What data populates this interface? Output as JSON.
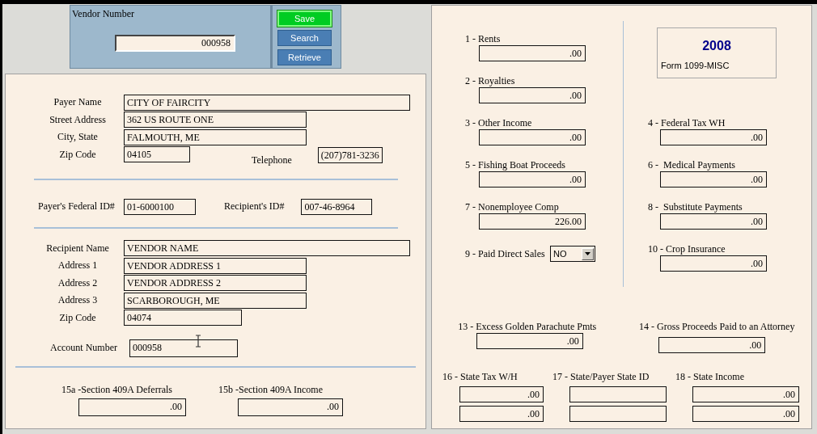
{
  "vendor_panel": {
    "label": "Vendor Number",
    "value": "000958"
  },
  "buttons": [
    {
      "label": "Save",
      "selected": true
    },
    {
      "label": "Search",
      "selected": false
    },
    {
      "label": "Retrieve",
      "selected": false
    }
  ],
  "payer": [
    {
      "label": "Payer Name",
      "value": "CITY OF FAIRCITY"
    },
    {
      "label": "Street Address",
      "value": "362 US ROUTE ONE"
    },
    {
      "label": "City, State",
      "value": "FALMOUTH, ME"
    },
    {
      "label": "Zip Code",
      "value": "04105"
    }
  ],
  "telephone": {
    "label": "Telephone",
    "value": "(207)781-3236"
  },
  "ids": [
    {
      "label": "Payer's Federal ID#",
      "value": "01-6000100"
    },
    {
      "label": "Recipient's ID#",
      "value": "007-46-8964"
    }
  ],
  "recipient": [
    {
      "label": "Recipient Name",
      "value": "VENDOR NAME"
    },
    {
      "label": "Address 1",
      "value": "VENDOR ADDRESS 1"
    },
    {
      "label": "Address 2",
      "value": "VENDOR ADDRESS 2"
    },
    {
      "label": "Address 3",
      "value": "SCARBOROUGH, ME"
    },
    {
      "label": "Zip Code",
      "value": "04074"
    }
  ],
  "account": {
    "label": "Account Number",
    "value": "000958"
  },
  "section_409a": [
    {
      "label": "15a -Section 409A Deferrals",
      "value": ".00"
    },
    {
      "label": "15b -Section 409A Income",
      "value": ".00"
    }
  ],
  "form_badge": {
    "year": "2008",
    "title": "Form 1099-MISC"
  },
  "boxes_left": [
    {
      "label": "1 - Rents",
      "value": ".00"
    },
    {
      "label": "2 - Royalties",
      "value": ".00"
    },
    {
      "label": "3 - Other Income",
      "value": ".00"
    },
    {
      "label": "5 - Fishing Boat Proceeds",
      "value": ".00"
    },
    {
      "label": "7 - Nonemployee Comp",
      "value": "226.00"
    }
  ],
  "paid_direct_sales": {
    "label": "9 - Paid Direct Sales",
    "value": "NO"
  },
  "boxes_right": [
    {
      "label": "4 - Federal Tax WH",
      "value": ".00"
    },
    {
      "label": "6 -  Medical Payments",
      "value": ".00"
    },
    {
      "label": "8 -  Substitute Payments",
      "value": ".00"
    },
    {
      "label": "10 - Crop Insurance",
      "value": ".00"
    }
  ],
  "boxes_lower": [
    {
      "label": "13 - Excess Golden Parachute Pmts",
      "value": ".00"
    },
    {
      "label": "14 - Gross Proceeds Paid to an Attorney",
      "value": ".00"
    }
  ],
  "state_columns": [
    {
      "label": "16 - State Tax W/H",
      "fields": [
        {
          "kind": "amount",
          "value": ".00"
        },
        {
          "kind": "amount",
          "value": ".00"
        }
      ]
    },
    {
      "label": "17 - State/Payer State ID",
      "fields": [
        {
          "kind": "blank"
        },
        {
          "kind": "blank"
        }
      ]
    },
    {
      "label": "18 - State Income",
      "fields": [
        {
          "kind": "amount",
          "value": ".00"
        },
        {
          "kind": "amount",
          "value": ".00"
        }
      ]
    }
  ]
}
